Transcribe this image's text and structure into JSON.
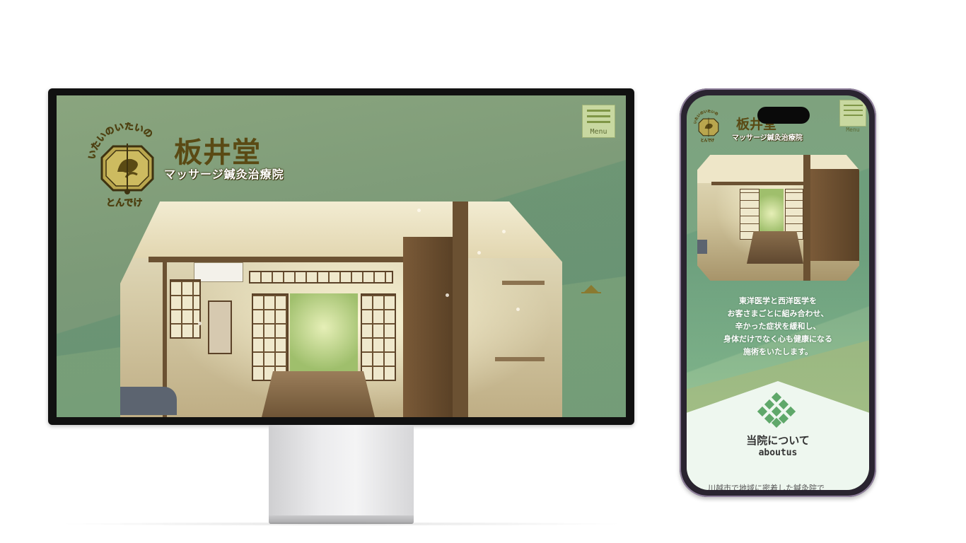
{
  "site": {
    "name": "板井堂",
    "subtitle": "マッサージ鍼灸治療院",
    "badge_arc_top": "いたいのいたいの",
    "badge_arc_bottom": "とんでけ",
    "menu_label": "Menu"
  },
  "hero": {
    "alt": "和室の治療室イラスト"
  },
  "mobile": {
    "lead_lines": [
      "東洋医学と西洋医学を",
      "お客さまごとに組み合わせ、",
      "辛かった症状を緩和し、",
      "身体だけでなく心も健康になる",
      "施術をいたします。"
    ],
    "about_title": "当院について",
    "about_sub": "aboutus",
    "body_text": "川越市で地域に密着した鍼灸院で"
  },
  "colors": {
    "bg_green": "#7c9a78",
    "menu_bg": "#c8d8a0",
    "logo_brown": "#5a4a14",
    "white_panel": "#eef7ef"
  },
  "icons": [
    "hamburger-menu-icon",
    "slide-arrow-icon",
    "diamond-cluster-icon",
    "logo-badge-icon"
  ]
}
